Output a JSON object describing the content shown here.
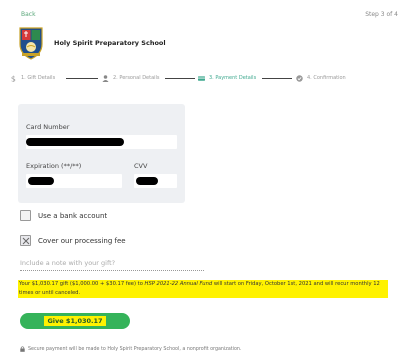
{
  "header": {
    "back_label": "Back",
    "step_indicator": "Step 3 of 4"
  },
  "school": {
    "name": "Holy Spirit Preparatory School",
    "crest_icon": "school-crest-icon"
  },
  "steps": [
    {
      "label": "1. Gift Details",
      "icon": "dollar-icon",
      "active": false
    },
    {
      "label": "2. Personal Details",
      "icon": "person-icon",
      "active": false
    },
    {
      "label": "3. Payment Details",
      "icon": "credit-card-icon",
      "active": true
    },
    {
      "label": "4. Confirmation",
      "icon": "check-circle-icon",
      "active": false
    }
  ],
  "payment": {
    "card_number_label": "Card Number",
    "expiration_label": "Expiration (**/**)",
    "cvv_label": "CVV"
  },
  "options": {
    "bank_account_label": "Use a bank account",
    "bank_account_checked": false,
    "cover_fee_label": "Cover our processing fee",
    "cover_fee_checked": true
  },
  "note": {
    "placeholder": "Include a note with your gift?"
  },
  "summary": {
    "part1": "Your $1,030.17 gift ($1,000.00 + $30.17 fee) to ",
    "fund": "HSP 2021-22 Annual Fund",
    "part2": " will start on Friday, October 1st, 2021 and will recur monthly 12 times or until canceled."
  },
  "give_button_label": "Give $1,030.17",
  "footer": {
    "secure_text": "Secure payment will be made to Holy Spirit Preparatory School, a nonprofit organization."
  },
  "colors": {
    "accent_green": "#35b35a",
    "active_step": "#3fa98f",
    "highlight": "#fff200"
  }
}
